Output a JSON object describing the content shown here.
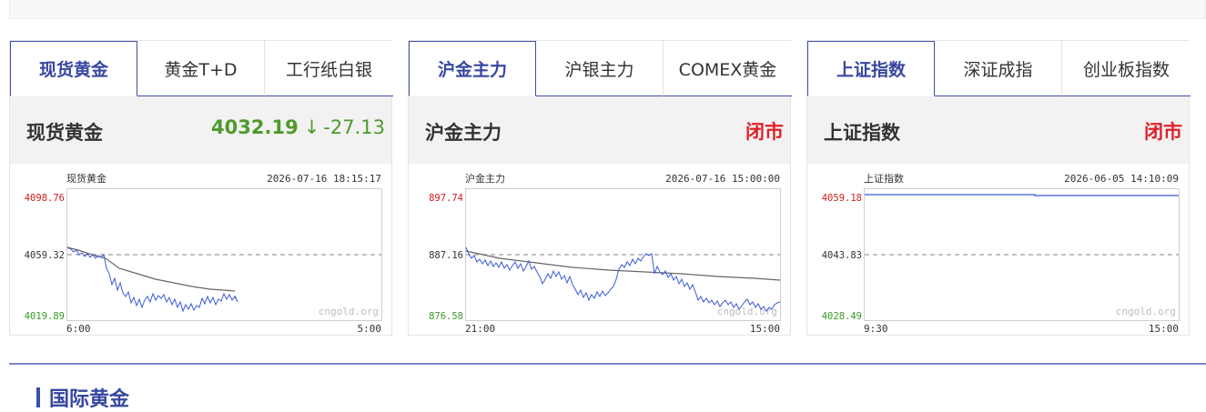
{
  "colors": {
    "accent": "#3d4fa8",
    "up": "#e0202a",
    "down": "#4d9a2b",
    "line": "#3a5ad8",
    "avg": "#666666"
  },
  "panels": [
    {
      "tabs": [
        {
          "label": "现货黄金",
          "active": true
        },
        {
          "label": "黄金T+D",
          "active": false
        },
        {
          "label": "工行纸白银",
          "active": false
        }
      ],
      "info": {
        "name": "现货黄金",
        "price": "4032.19",
        "arrow": "↓",
        "change": "-27.13",
        "status": ""
      },
      "chart": {
        "title": "现货黄金",
        "datetime": "2026-07-16 18:15:17",
        "y_high": "4098.76",
        "y_mid": "4059.32",
        "y_low": "4019.89",
        "x_start": "6:00",
        "x_end": "5:00",
        "watermark": "cngold.org"
      }
    },
    {
      "tabs": [
        {
          "label": "沪金主力",
          "active": true
        },
        {
          "label": "沪银主力",
          "active": false
        },
        {
          "label": "COMEX黄金",
          "active": false
        }
      ],
      "info": {
        "name": "沪金主力",
        "price": "",
        "arrow": "",
        "change": "",
        "status": "闭市"
      },
      "chart": {
        "title": "沪金主力",
        "datetime": "2026-07-16 15:00:00",
        "y_high": "897.74",
        "y_mid": "887.16",
        "y_low": "876.58",
        "x_start": "21:00",
        "x_end": "15:00",
        "watermark": "cngold.org"
      }
    },
    {
      "tabs": [
        {
          "label": "上证指数",
          "active": true
        },
        {
          "label": "深证成指",
          "active": false
        },
        {
          "label": "创业板指数",
          "active": false
        }
      ],
      "info": {
        "name": "上证指数",
        "price": "",
        "arrow": "",
        "change": "",
        "status": "闭市"
      },
      "chart": {
        "title": "上证指数",
        "datetime": "2026-06-05 14:10:09",
        "y_high": "4059.18",
        "y_mid": "4043.83",
        "y_low": "4028.49",
        "x_start": "9:30",
        "x_end": "15:00",
        "watermark": "cngold.org"
      }
    }
  ],
  "section": {
    "title": "国际黄金"
  }
}
